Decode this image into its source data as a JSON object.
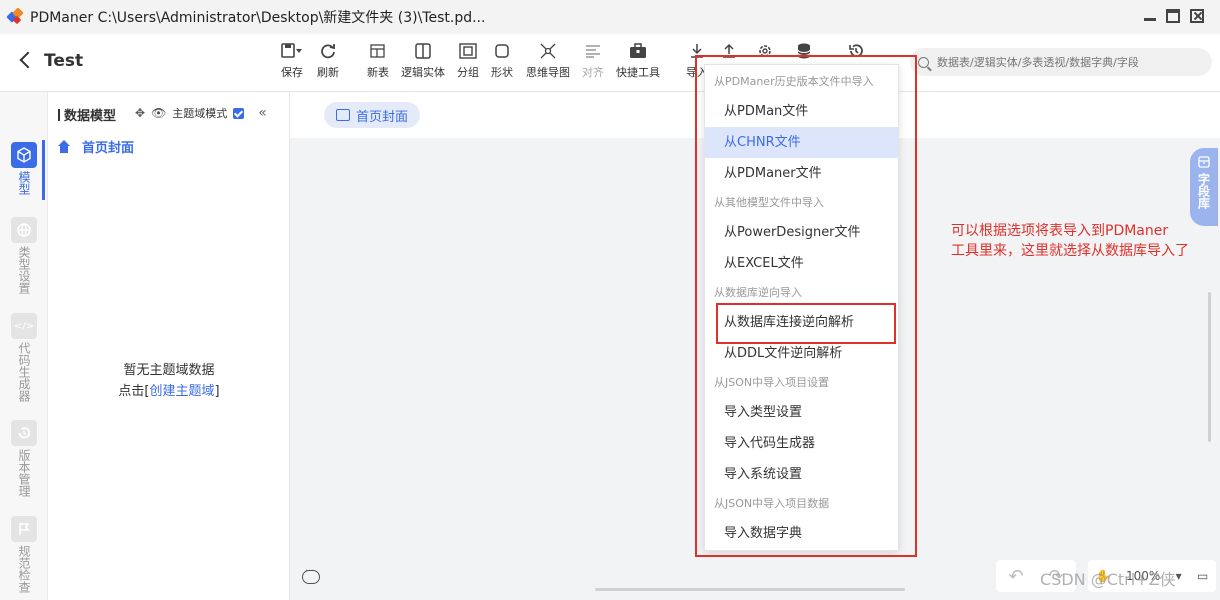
{
  "window": {
    "title": "PDManer  C:\\Users\\Administrator\\Desktop\\新建文件夹 (3)\\Test.pd...",
    "logo_colors": [
      "#3b6ce8",
      "#f08a24",
      "#e0302a"
    ]
  },
  "header": {
    "project_title": "Test",
    "tools": [
      {
        "label": "保存",
        "icon": "save-icon"
      },
      {
        "label": "刷新",
        "icon": "refresh-icon"
      },
      {
        "label": "新表",
        "icon": "new-table-icon"
      },
      {
        "label": "逻辑实体",
        "icon": "logic-entity-icon"
      },
      {
        "label": "分组",
        "icon": "group-icon"
      },
      {
        "label": "形状",
        "icon": "shape-icon"
      },
      {
        "label": "思维导图",
        "icon": "mindmap-icon"
      },
      {
        "label": "对齐",
        "icon": "align-icon"
      },
      {
        "label": "快捷工具",
        "icon": "toolbox-icon"
      },
      {
        "label": "导入",
        "icon": "import-icon"
      }
    ],
    "search_placeholder": "数据表/逻辑实体/多表透视/数据字典/字段"
  },
  "leftnav": {
    "items": [
      {
        "label": "模型",
        "icon": "cube-icon",
        "active": true
      },
      {
        "label": "类型设置",
        "icon": "globe-icon",
        "active": false
      },
      {
        "label": "代码生成器",
        "icon": "code-icon",
        "active": false
      },
      {
        "label": "版本管理",
        "icon": "history-icon",
        "active": false
      },
      {
        "label": "规范检查",
        "icon": "flag-icon",
        "active": false
      }
    ]
  },
  "model_panel": {
    "title": "数据模型",
    "mode_label": "主题域模式",
    "mode_checked": true,
    "home_label": "首页封面",
    "empty_text": "暂无主题域数据",
    "create_prefix": "点击[",
    "create_link": "创建主题域",
    "create_suffix": "]"
  },
  "main": {
    "tab_label": "首页封面",
    "field_library": "字段库",
    "annotation": "可以根据选项将表导入到PDManer\n工具里来，这里就选择从数据库导入了",
    "zoom": "100%"
  },
  "import_menu": {
    "groups": [
      {
        "title": "从PDManer历史版本文件中导入",
        "items": [
          "从PDMan文件",
          "从CHNR文件",
          "从PDManer文件"
        ]
      },
      {
        "title": "从其他模型文件中导入",
        "items": [
          "从PowerDesigner文件",
          "从EXCEL文件"
        ]
      },
      {
        "title": "从数据库逆向导入",
        "items": [
          "从数据库连接逆向解析",
          "从DDL文件逆向解析"
        ]
      },
      {
        "title": "从JSON中导入项目设置",
        "items": [
          "导入类型设置",
          "导入代码生成器",
          "导入系统设置"
        ]
      },
      {
        "title": "从JSON中导入项目数据",
        "items": [
          "导入数据字典"
        ]
      }
    ],
    "selected_item": "从CHNR文件",
    "highlighted_item": "从数据库连接逆向解析"
  },
  "watermark": "CSDN @Ctrl+Z侠",
  "colors": {
    "accent": "#3b6ce8",
    "annotation": "#e0302a",
    "selected_bg": "#dde5fb"
  }
}
